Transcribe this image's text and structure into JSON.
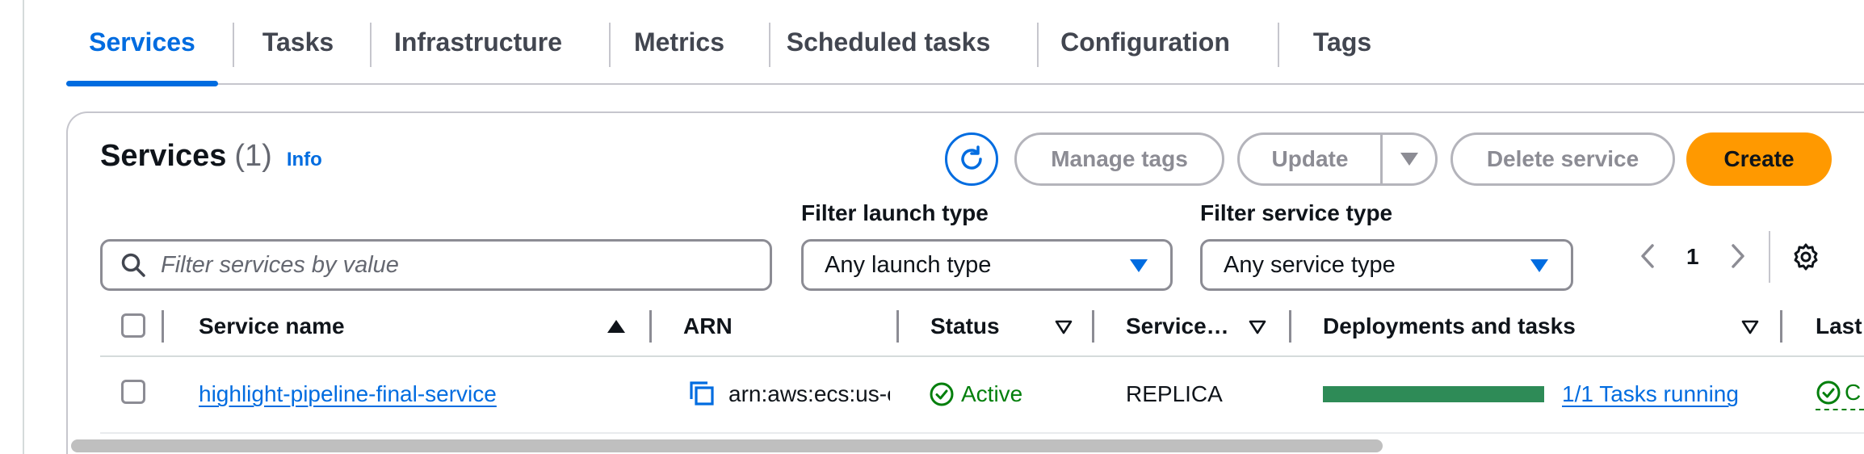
{
  "tabs": [
    {
      "label": "Services",
      "active": true
    },
    {
      "label": "Tasks"
    },
    {
      "label": "Infrastructure"
    },
    {
      "label": "Metrics"
    },
    {
      "label": "Scheduled tasks"
    },
    {
      "label": "Configuration"
    },
    {
      "label": "Tags"
    }
  ],
  "header": {
    "title": "Services",
    "count": "(1)",
    "info_link": "Info"
  },
  "actions": {
    "refresh_icon": "refresh-icon",
    "manage_tags": "Manage tags",
    "update": "Update",
    "delete_service": "Delete service",
    "create": "Create"
  },
  "filters": {
    "search_placeholder": "Filter services by value",
    "launch_type_label": "Filter launch type",
    "launch_type_value": "Any launch type",
    "service_type_label": "Filter service type",
    "service_type_value": "Any service type"
  },
  "pagination": {
    "prev": "‹",
    "current_page": "1",
    "next": "›"
  },
  "table": {
    "columns": [
      "Service name",
      "ARN",
      "Status",
      "Service…",
      "Deployments and tasks",
      "Last"
    ],
    "rows": [
      {
        "service_name": "highlight-pipeline-final-service",
        "arn": "arn:aws:ecs:us-e",
        "status": "Active",
        "service_type": "REPLICA",
        "deployment_progress": 1.0,
        "tasks": "1/1 Tasks running",
        "last_status_partial": "C"
      }
    ]
  },
  "colors": {
    "accent": "#006ce0",
    "primary_button": "#ff9900",
    "success": "#037f0c",
    "progress": "#2e8b57"
  }
}
